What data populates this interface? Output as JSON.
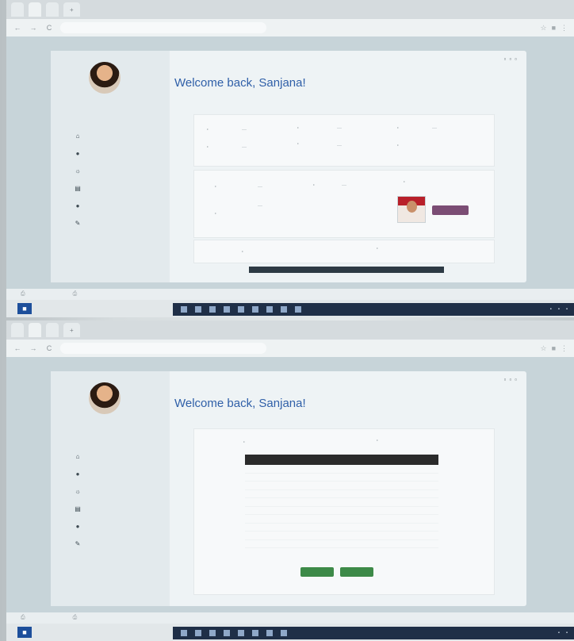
{
  "browser": {
    "tabs": [
      "",
      "",
      ""
    ],
    "url": "",
    "new_tab": "+",
    "nav": {
      "back": "←",
      "forward": "→",
      "reload": "C"
    }
  },
  "app": {
    "welcome": "Welcome back, Sanjana!",
    "subtitle": "",
    "email": "",
    "sidebar": {
      "user_name": "",
      "items": [
        {
          "label": "",
          "icon": "home-icon"
        },
        {
          "label": "",
          "icon": "profile-icon"
        },
        {
          "label": "",
          "icon": "documents-icon"
        },
        {
          "label": "",
          "icon": "leave-icon"
        },
        {
          "label": "",
          "icon": "settings-icon"
        },
        {
          "label": "",
          "icon": "logout-icon"
        }
      ]
    }
  },
  "taskbar": {
    "start_glyph": "■",
    "search_placeholder": ""
  },
  "bottom_table": {
    "headers": [
      "",
      ""
    ],
    "rows": [
      [
        "",
        ""
      ],
      [
        "",
        ""
      ],
      [
        "",
        ""
      ],
      [
        "",
        ""
      ],
      [
        "",
        ""
      ],
      [
        "",
        ""
      ],
      [
        "",
        ""
      ],
      [
        "",
        ""
      ],
      [
        "",
        ""
      ],
      [
        "",
        ""
      ]
    ]
  },
  "colors": {
    "welcome_text": "#2f5fa8",
    "action_button": "#7b4d74",
    "submit_buttons": "#3d8a48",
    "table_header": "#2b2b2b",
    "taskbar": "#1f2f47"
  }
}
